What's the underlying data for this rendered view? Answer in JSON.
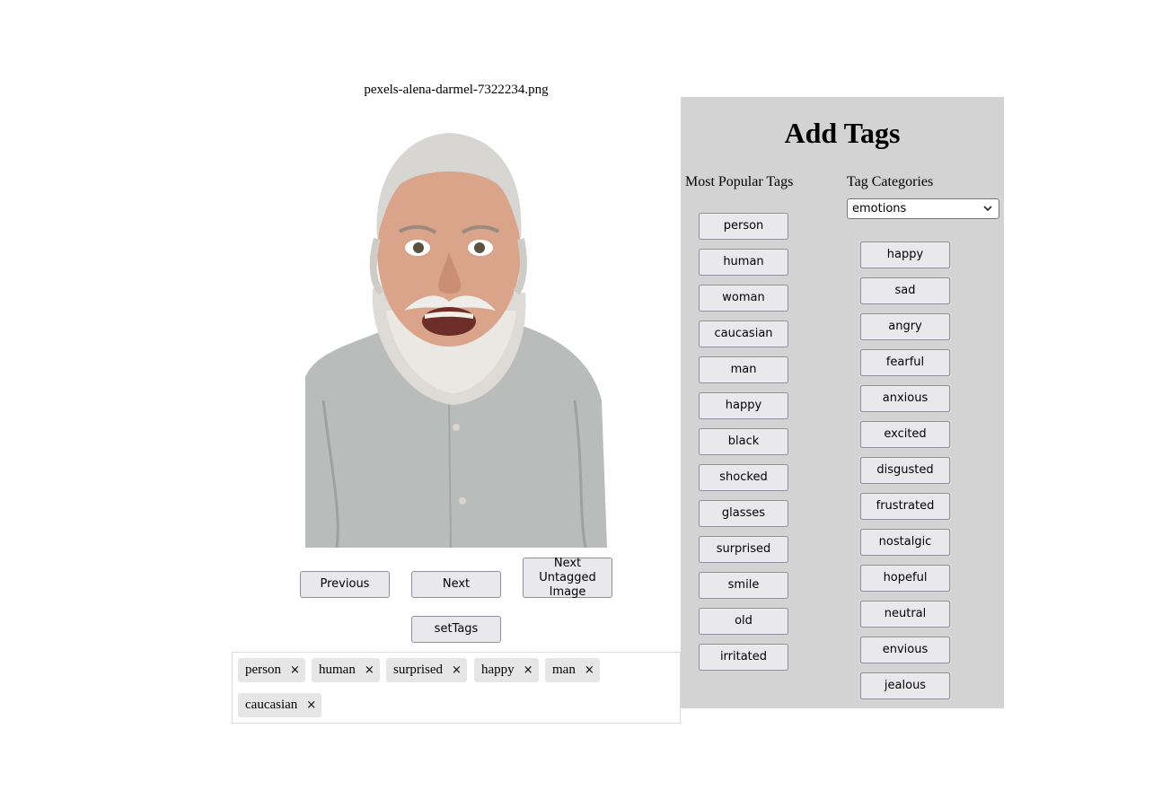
{
  "image": {
    "filename": "pexels-alena-darmel-7322234.png"
  },
  "nav": {
    "previous": "Previous",
    "next": "Next",
    "next_untagged": "Next Untagged Image",
    "set_tags": "setTags"
  },
  "selected_tags": [
    "person",
    "human",
    "surprised",
    "happy",
    "man",
    "caucasian"
  ],
  "remove_glyph": "×",
  "panel": {
    "title": "Add Tags",
    "popular_heading": "Most Popular Tags",
    "categories_heading": "Tag Categories",
    "category_selected": "emotions",
    "popular_tags": [
      "person",
      "human",
      "woman",
      "caucasian",
      "man",
      "happy",
      "black",
      "shocked",
      "glasses",
      "surprised",
      "smile",
      "old",
      "irritated"
    ],
    "category_tags": [
      "happy",
      "sad",
      "angry",
      "fearful",
      "anxious",
      "excited",
      "disgusted",
      "frustrated",
      "nostalgic",
      "hopeful",
      "neutral",
      "envious",
      "jealous"
    ]
  },
  "colors": {
    "panel_bg": "#d3d3d3",
    "button_bg": "#e9e9ed",
    "chip_bg": "#e6e6e6"
  }
}
